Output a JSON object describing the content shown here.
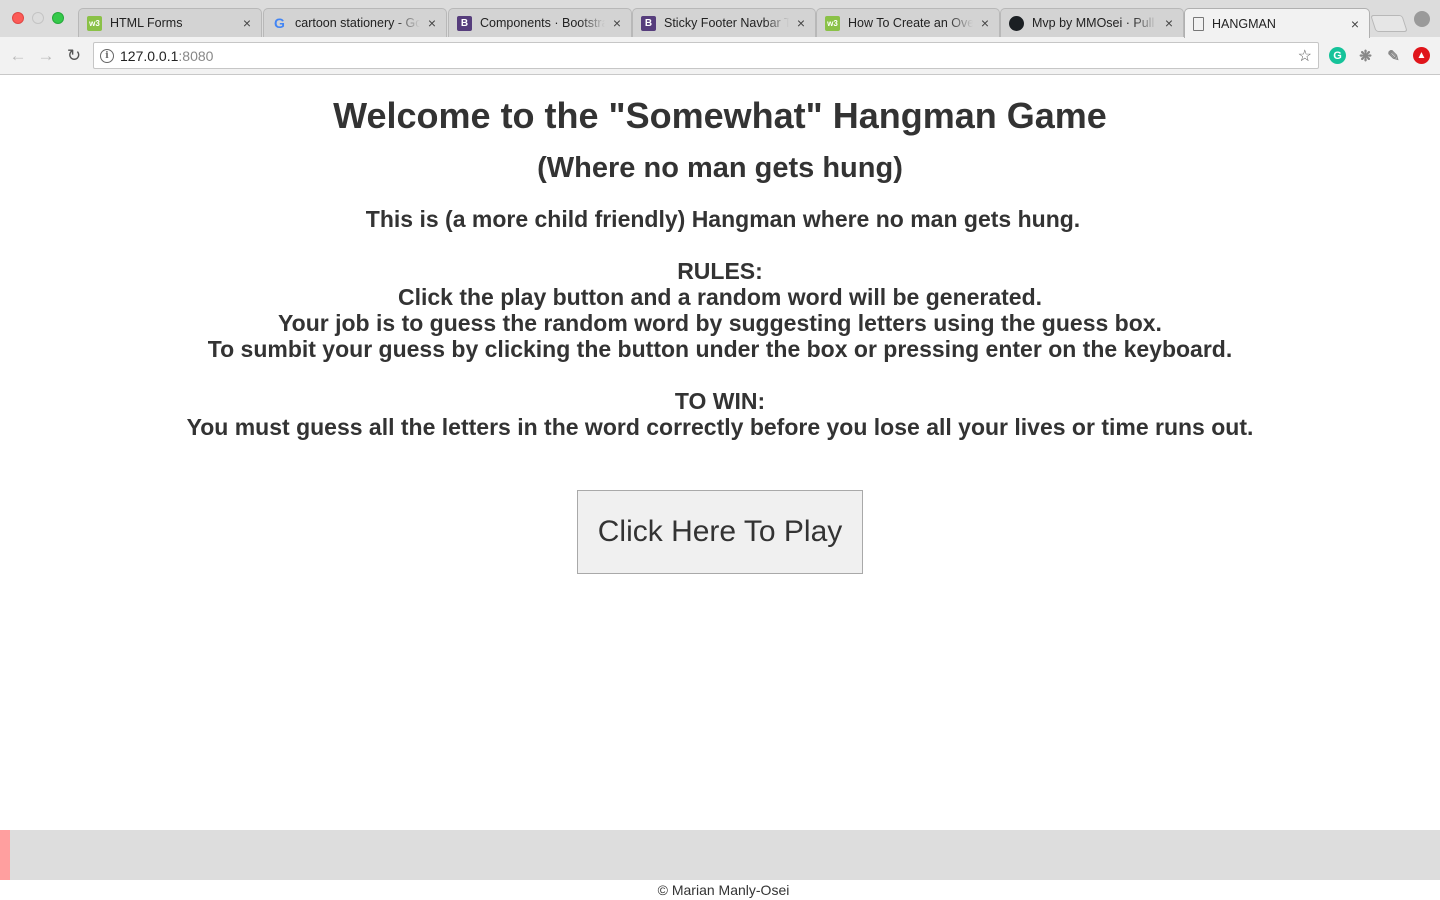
{
  "browser": {
    "tabs": [
      {
        "title": "HTML Forms",
        "favicon": "w3schools-icon"
      },
      {
        "title": "cartoon stationery - Google Search",
        "favicon": "google-icon"
      },
      {
        "title": "Components · Bootstrap",
        "favicon": "bootstrap-icon"
      },
      {
        "title": "Sticky Footer Navbar Template",
        "favicon": "bootstrap-icon"
      },
      {
        "title": "How To Create an Overlay",
        "favicon": "w3schools-icon"
      },
      {
        "title": "Mvp by MMOsei · Pull Request",
        "favicon": "github-icon"
      },
      {
        "title": "HANGMAN",
        "favicon": "document-icon"
      }
    ],
    "active_tab": 6,
    "url_host": "127.0.0.1",
    "url_port": ":8080",
    "close_glyph": "×"
  },
  "page": {
    "heading": "Welcome to the \"Somewhat\" Hangman Game",
    "subheading": "(Where no man gets hung)",
    "intro": "This is (a more child friendly) Hangman where no man gets hung.",
    "rules_title": "RULES:",
    "rules": [
      "Click the play button and a random word will be generated.",
      "Your job is to guess the random word by suggesting letters using the guess box.",
      "To sumbit your guess by clicking the button under the box or pressing enter on the keyboard."
    ],
    "win_title": "TO WIN:",
    "win_text": "You must guess all the letters in the word correctly before you lose all your lives or time runs out.",
    "play_button": "Click Here To Play",
    "copyright": "© Marian Manly-Osei"
  },
  "colors": {
    "text": "#333333",
    "footer_bar": "#dddddd",
    "footer_accent": "#ff9f9f"
  }
}
